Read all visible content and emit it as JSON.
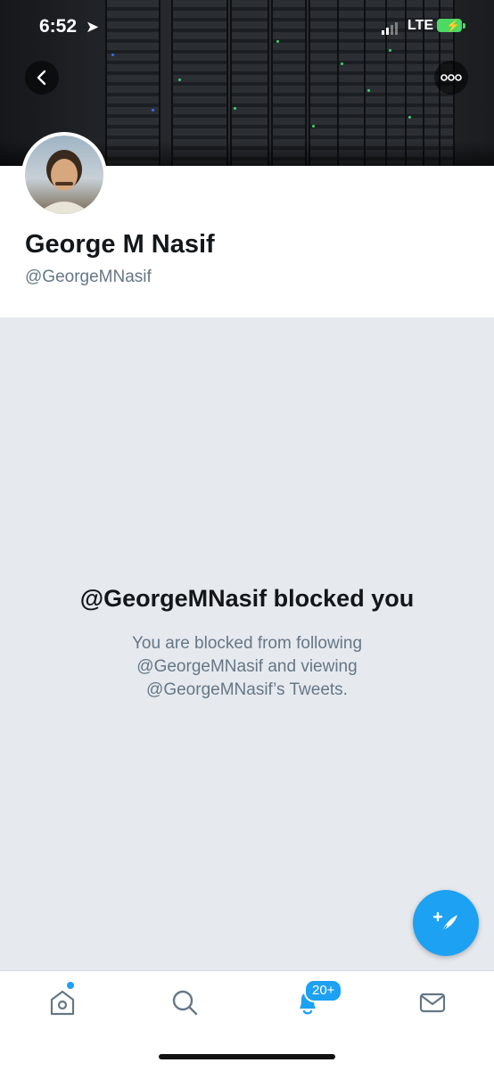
{
  "status_bar": {
    "time": "6:52",
    "network": "LTE"
  },
  "header": {
    "banner_image": "server-racks",
    "back_icon": "chevron-left-icon",
    "more_icon": "ellipsis-icon"
  },
  "profile": {
    "name": "George M Nasif",
    "handle": "@GeorgeMNasif"
  },
  "blocked": {
    "title": "@GeorgeMNasif blocked you",
    "body": "You are blocked from following @GeorgeMNasif and viewing @GeorgeMNasif’s Tweets."
  },
  "tab_bar": {
    "notification_badge": "20+"
  },
  "colors": {
    "accent": "#1da1f2",
    "text_primary": "#14171a",
    "text_secondary": "#657786",
    "background": "#e6e9ee"
  }
}
